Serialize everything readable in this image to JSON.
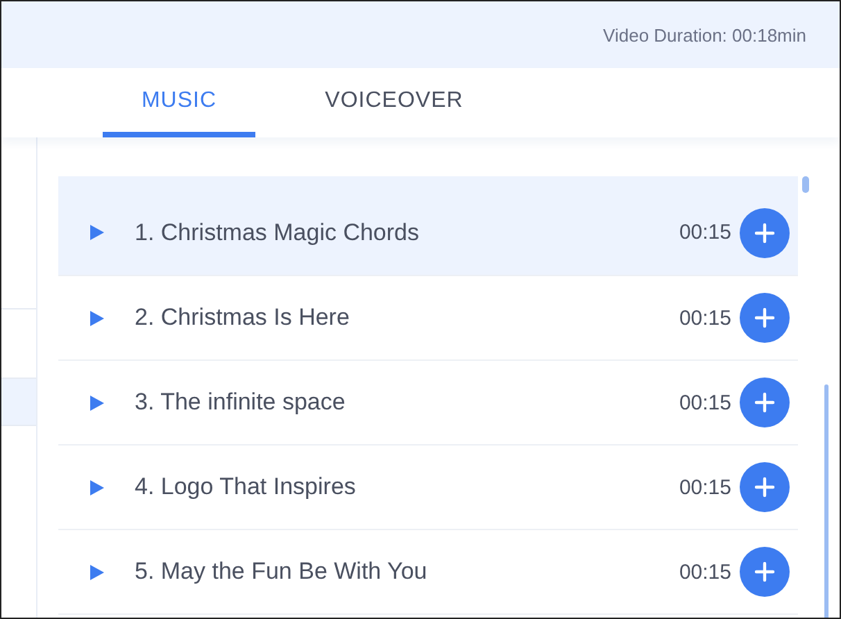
{
  "header": {
    "duration": "Video Duration: 00:18min"
  },
  "tabs": [
    {
      "label": "MUSIC",
      "selected": true
    },
    {
      "label": "VOICEOVER",
      "selected": false
    }
  ],
  "sidebar": {
    "items": [
      {
        "selected": false
      },
      {
        "selected": false
      },
      {
        "selected": true
      }
    ]
  },
  "tracks": [
    {
      "title": "1. Christmas Magic Chords",
      "duration": "00:15",
      "selected": true
    },
    {
      "title": "2. Christmas Is Here",
      "duration": "00:15",
      "selected": false
    },
    {
      "title": "3. The infinite space",
      "duration": "00:15",
      "selected": false
    },
    {
      "title": "4. Logo That Inspires",
      "duration": "00:15",
      "selected": false
    },
    {
      "title": "5. May the Fun Be With You",
      "duration": "00:15",
      "selected": false
    }
  ]
}
